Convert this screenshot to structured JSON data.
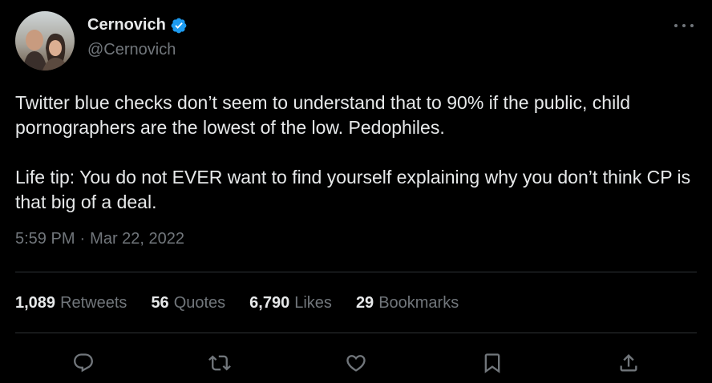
{
  "author": {
    "display_name": "Cernovich",
    "handle": "@Cernovich",
    "verified": true
  },
  "tweet": {
    "paragraphs": [
      "Twitter blue checks don’t seem to understand that to 90% if the public, child pornographers are the lowest of the low. Pedophiles.",
      "Life tip: You do not EVER want to find yourself explaining why you don’t think CP is that big of a deal."
    ],
    "time": "5:59 PM",
    "separator": "·",
    "date": "Mar 22, 2022"
  },
  "stats": {
    "retweets": {
      "count": "1,089",
      "label": "Retweets"
    },
    "quotes": {
      "count": "56",
      "label": "Quotes"
    },
    "likes": {
      "count": "6,790",
      "label": "Likes"
    },
    "bookmarks": {
      "count": "29",
      "label": "Bookmarks"
    }
  },
  "actions": {
    "icons": [
      "reply-icon",
      "retweet-icon",
      "like-icon",
      "bookmark-icon",
      "share-icon"
    ]
  },
  "colors": {
    "background": "#000000",
    "text_primary": "#e7e9ea",
    "text_secondary": "#71767b",
    "verified_blue": "#1d9bf0",
    "divider": "#2f3336"
  }
}
